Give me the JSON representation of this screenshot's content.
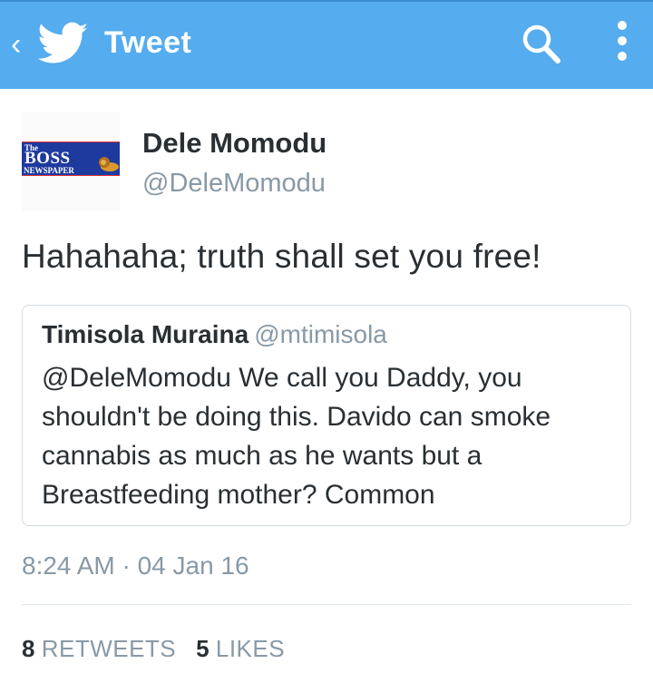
{
  "appbar": {
    "title": "Tweet",
    "back_glyph": "‹",
    "icons": [
      "back-icon",
      "twitter-bird-icon",
      "search-icon",
      "overflow-menu-icon"
    ],
    "background": "#55acee"
  },
  "tweet": {
    "author_name": "Dele Momodu",
    "author_handle": "@DeleMomodu",
    "avatar_logo": {
      "line1": "The",
      "line2": "BOSS",
      "line3": "NEWSPAPER"
    },
    "text": "Hahahaha; truth shall set you free!",
    "timestamp": "8:24 AM · 04 Jan 16",
    "retweets_count": "8",
    "retweets_label": "RETWEETS",
    "likes_count": "5",
    "likes_label": "LIKES"
  },
  "quoted_tweet": {
    "author_name": "Timisola Muraina",
    "author_handle": "@mtimisola",
    "text": "@DeleMomodu We call you Daddy, you shouldn't be doing this. Davido can smoke cannabis as much as he wants but a Breastfeeding mother? Common"
  },
  "colors": {
    "accent": "#55acee",
    "text": "#292f33",
    "muted": "#8899a6",
    "border": "#d3dbe1"
  }
}
